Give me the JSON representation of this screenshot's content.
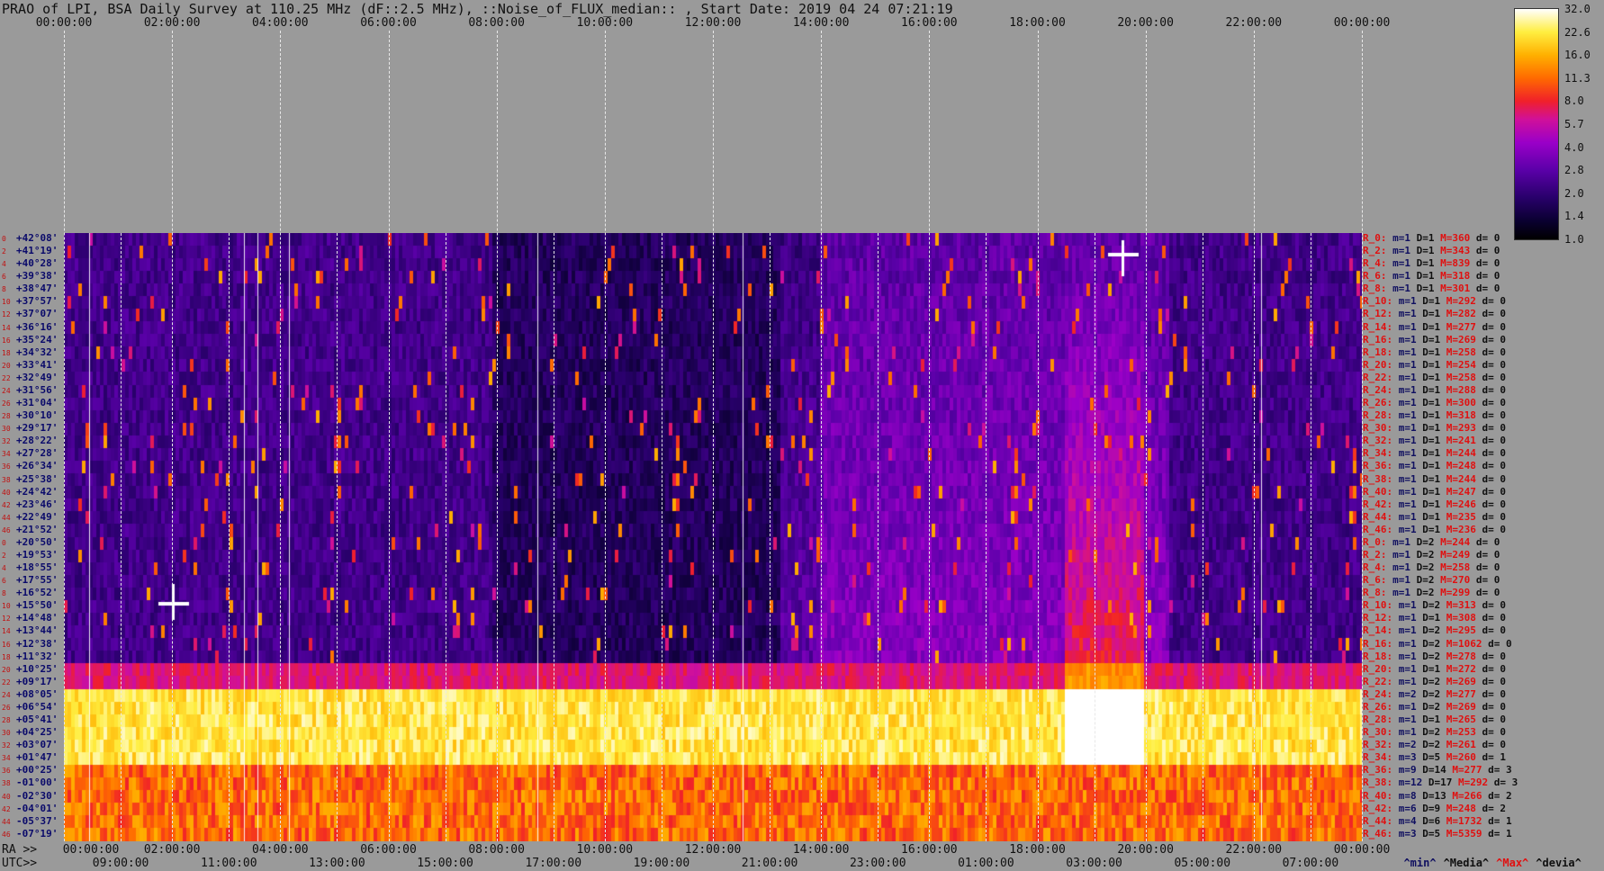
{
  "title": "PRAO of LPI, BSA Daily Survey at 110.25 MHz (dF::2.5 MHz), ::Noise_of_FLUX_median:: , Start Date: 2019 04 24 07:21:19",
  "top_ticks": [
    "00:00:00",
    "02:00:00",
    "04:00:00",
    "06:00:00",
    "08:00:00",
    "10:00:00",
    "12:00:00",
    "14:00:00",
    "16:00:00",
    "18:00:00",
    "20:00:00",
    "22:00:00",
    "00:00:00"
  ],
  "ra_label": "RA >>",
  "utc_label": "UTC>>",
  "ra_ticks": [
    "00:00:00",
    "02:00:00",
    "04:00:00",
    "06:00:00",
    "08:00:00",
    "10:00:00",
    "12:00:00",
    "14:00:00",
    "16:00:00",
    "18:00:00",
    "20:00:00",
    "22:00:00",
    "00:00:00"
  ],
  "utc_ticks": [
    "09:00:00",
    "11:00:00",
    "13:00:00",
    "15:00:00",
    "17:00:00",
    "19:00:00",
    "21:00:00",
    "23:00:00",
    "01:00:00",
    "03:00:00",
    "05:00:00",
    "07:00:00"
  ],
  "colorbar": {
    "ticks": [
      "32.0",
      "22.6",
      "16.0",
      "11.3",
      "8.0",
      "5.7",
      "4.0",
      "2.8",
      "2.0",
      "1.4",
      "1.0"
    ]
  },
  "legend": {
    "min": "^min^",
    "median": "^Media^",
    "max": "^Max^",
    "devia": "^devia^"
  },
  "chart_data": {
    "type": "heatmap",
    "title": "PRAO of LPI, BSA Daily Survey at 110.25 MHz (dF::2.5 MHz), ::Noise_of_FLUX_median:: , Start Date: 2019 04 24 07:21:19",
    "x_axis": "RA 00:00:00 to 24:00:00 (UTC 07:21:19 start)",
    "rows": [
      {
        "idx": "0",
        "dec": "+42°08'",
        "stat": "R_0:",
        "min": "m=1",
        "d1": "D=1",
        "max": "M=360",
        "dev": "d= 0"
      },
      {
        "idx": "2",
        "dec": "+41°19'",
        "stat": "R_2:",
        "min": "m=1",
        "d1": "D=1",
        "max": "M=343",
        "dev": "d= 0"
      },
      {
        "idx": "4",
        "dec": "+40°28'",
        "stat": "R_4:",
        "min": "m=1",
        "d1": "D=1",
        "max": "M=839",
        "dev": "d= 0"
      },
      {
        "idx": "6",
        "dec": "+39°38'",
        "stat": "R_6:",
        "min": "m=1",
        "d1": "D=1",
        "max": "M=318",
        "dev": "d= 0"
      },
      {
        "idx": "8",
        "dec": "+38°47'",
        "stat": "R_8:",
        "min": "m=1",
        "d1": "D=1",
        "max": "M=301",
        "dev": "d= 0"
      },
      {
        "idx": "10",
        "dec": "+37°57'",
        "stat": "R_10:",
        "min": "m=1",
        "d1": "D=1",
        "max": "M=292",
        "dev": "d= 0"
      },
      {
        "idx": "12",
        "dec": "+37°07'",
        "stat": "R_12:",
        "min": "m=1",
        "d1": "D=1",
        "max": "M=282",
        "dev": "d= 0"
      },
      {
        "idx": "14",
        "dec": "+36°16'",
        "stat": "R_14:",
        "min": "m=1",
        "d1": "D=1",
        "max": "M=277",
        "dev": "d= 0"
      },
      {
        "idx": "16",
        "dec": "+35°24'",
        "stat": "R_16:",
        "min": "m=1",
        "d1": "D=1",
        "max": "M=269",
        "dev": "d= 0"
      },
      {
        "idx": "18",
        "dec": "+34°32'",
        "stat": "R_18:",
        "min": "m=1",
        "d1": "D=1",
        "max": "M=258",
        "dev": "d= 0"
      },
      {
        "idx": "20",
        "dec": "+33°41'",
        "stat": "R_20:",
        "min": "m=1",
        "d1": "D=1",
        "max": "M=254",
        "dev": "d= 0"
      },
      {
        "idx": "22",
        "dec": "+32°49'",
        "stat": "R_22:",
        "min": "m=1",
        "d1": "D=1",
        "max": "M=258",
        "dev": "d= 0"
      },
      {
        "idx": "24",
        "dec": "+31°56'",
        "stat": "R_24:",
        "min": "m=1",
        "d1": "D=1",
        "max": "M=288",
        "dev": "d= 0"
      },
      {
        "idx": "26",
        "dec": "+31°04'",
        "stat": "R_26:",
        "min": "m=1",
        "d1": "D=1",
        "max": "M=300",
        "dev": "d= 0"
      },
      {
        "idx": "28",
        "dec": "+30°10'",
        "stat": "R_28:",
        "min": "m=1",
        "d1": "D=1",
        "max": "M=318",
        "dev": "d= 0"
      },
      {
        "idx": "30",
        "dec": "+29°17'",
        "stat": "R_30:",
        "min": "m=1",
        "d1": "D=1",
        "max": "M=293",
        "dev": "d= 0"
      },
      {
        "idx": "32",
        "dec": "+28°22'",
        "stat": "R_32:",
        "min": "m=1",
        "d1": "D=1",
        "max": "M=241",
        "dev": "d= 0"
      },
      {
        "idx": "34",
        "dec": "+27°28'",
        "stat": "R_34:",
        "min": "m=1",
        "d1": "D=1",
        "max": "M=244",
        "dev": "d= 0"
      },
      {
        "idx": "36",
        "dec": "+26°34'",
        "stat": "R_36:",
        "min": "m=1",
        "d1": "D=1",
        "max": "M=248",
        "dev": "d= 0"
      },
      {
        "idx": "38",
        "dec": "+25°38'",
        "stat": "R_38:",
        "min": "m=1",
        "d1": "D=1",
        "max": "M=244",
        "dev": "d= 0"
      },
      {
        "idx": "40",
        "dec": "+24°42'",
        "stat": "R_40:",
        "min": "m=1",
        "d1": "D=1",
        "max": "M=247",
        "dev": "d= 0"
      },
      {
        "idx": "42",
        "dec": "+23°46'",
        "stat": "R_42:",
        "min": "m=1",
        "d1": "D=1",
        "max": "M=246",
        "dev": "d= 0"
      },
      {
        "idx": "44",
        "dec": "+22°49'",
        "stat": "R_44:",
        "min": "m=1",
        "d1": "D=1",
        "max": "M=235",
        "dev": "d= 0"
      },
      {
        "idx": "46",
        "dec": "+21°52'",
        "stat": "R_46:",
        "min": "m=1",
        "d1": "D=1",
        "max": "M=236",
        "dev": "d= 0"
      },
      {
        "idx": "0",
        "dec": "+20°50'",
        "stat": "R_0:",
        "min": "m=1",
        "d1": "D=2",
        "max": "M=244",
        "dev": "d= 0"
      },
      {
        "idx": "2",
        "dec": "+19°53'",
        "stat": "R_2:",
        "min": "m=1",
        "d1": "D=2",
        "max": "M=249",
        "dev": "d= 0"
      },
      {
        "idx": "4",
        "dec": "+18°55'",
        "stat": "R_4:",
        "min": "m=1",
        "d1": "D=2",
        "max": "M=258",
        "dev": "d= 0"
      },
      {
        "idx": "6",
        "dec": "+17°55'",
        "stat": "R_6:",
        "min": "m=1",
        "d1": "D=2",
        "max": "M=270",
        "dev": "d= 0"
      },
      {
        "idx": "8",
        "dec": "+16°52'",
        "stat": "R_8:",
        "min": "m=1",
        "d1": "D=2",
        "max": "M=299",
        "dev": "d= 0"
      },
      {
        "idx": "10",
        "dec": "+15°50'",
        "stat": "R_10:",
        "min": "m=1",
        "d1": "D=2",
        "max": "M=313",
        "dev": "d= 0"
      },
      {
        "idx": "12",
        "dec": "+14°48'",
        "stat": "R_12:",
        "min": "m=1",
        "d1": "D=1",
        "max": "M=308",
        "dev": "d= 0"
      },
      {
        "idx": "14",
        "dec": "+13°44'",
        "stat": "R_14:",
        "min": "m=1",
        "d1": "D=2",
        "max": "M=295",
        "dev": "d= 0"
      },
      {
        "idx": "16",
        "dec": "+12°38'",
        "stat": "R_16:",
        "min": "m=1",
        "d1": "D=2",
        "max": "M=1062",
        "dev": "d= 0"
      },
      {
        "idx": "18",
        "dec": "+11°32'",
        "stat": "R_18:",
        "min": "m=1",
        "d1": "D=2",
        "max": "M=278",
        "dev": "d= 0"
      },
      {
        "idx": "20",
        "dec": "+10°25'",
        "stat": "R_20:",
        "min": "m=1",
        "d1": "D=1",
        "max": "M=272",
        "dev": "d= 0"
      },
      {
        "idx": "22",
        "dec": "+09°17'",
        "stat": "R_22:",
        "min": "m=1",
        "d1": "D=2",
        "max": "M=269",
        "dev": "d= 0"
      },
      {
        "idx": "24",
        "dec": "+08°05'",
        "stat": "R_24:",
        "min": "m=2",
        "d1": "D=2",
        "max": "M=277",
        "dev": "d= 0"
      },
      {
        "idx": "26",
        "dec": "+06°54'",
        "stat": "R_26:",
        "min": "m=1",
        "d1": "D=2",
        "max": "M=269",
        "dev": "d= 0"
      },
      {
        "idx": "28",
        "dec": "+05°41'",
        "stat": "R_28:",
        "min": "m=1",
        "d1": "D=1",
        "max": "M=265",
        "dev": "d= 0"
      },
      {
        "idx": "30",
        "dec": "+04°25'",
        "stat": "R_30:",
        "min": "m=1",
        "d1": "D=2",
        "max": "M=253",
        "dev": "d= 0"
      },
      {
        "idx": "32",
        "dec": "+03°07'",
        "stat": "R_32:",
        "min": "m=2",
        "d1": "D=2",
        "max": "M=261",
        "dev": "d= 0"
      },
      {
        "idx": "34",
        "dec": "+01°47'",
        "stat": "R_34:",
        "min": "m=3",
        "d1": "D=5",
        "max": "M=260",
        "dev": "d= 1"
      },
      {
        "idx": "36",
        "dec": "+00°25'",
        "stat": "R_36:",
        "min": "m=9",
        "d1": "D=14",
        "max": "M=277",
        "dev": "d= 3"
      },
      {
        "idx": "38",
        "dec": "-01°00'",
        "stat": "R_38:",
        "min": "m=12",
        "d1": "D=17",
        "max": "M=292",
        "dev": "d= 3"
      },
      {
        "idx": "40",
        "dec": "-02°30'",
        "stat": "R_40:",
        "min": "m=8",
        "d1": "D=13",
        "max": "M=266",
        "dev": "d= 2"
      },
      {
        "idx": "42",
        "dec": "-04°01'",
        "stat": "R_42:",
        "min": "m=6",
        "d1": "D=9",
        "max": "M=248",
        "dev": "d= 2"
      },
      {
        "idx": "44",
        "dec": "-05°37'",
        "stat": "R_44:",
        "min": "m=4",
        "d1": "D=6",
        "max": "M=1732",
        "dev": "d= 1"
      },
      {
        "idx": "46",
        "dec": "-07°19'",
        "stat": "R_46:",
        "min": "m=3",
        "d1": "D=5",
        "max": "M=5359",
        "dev": "d= 1"
      }
    ]
  }
}
